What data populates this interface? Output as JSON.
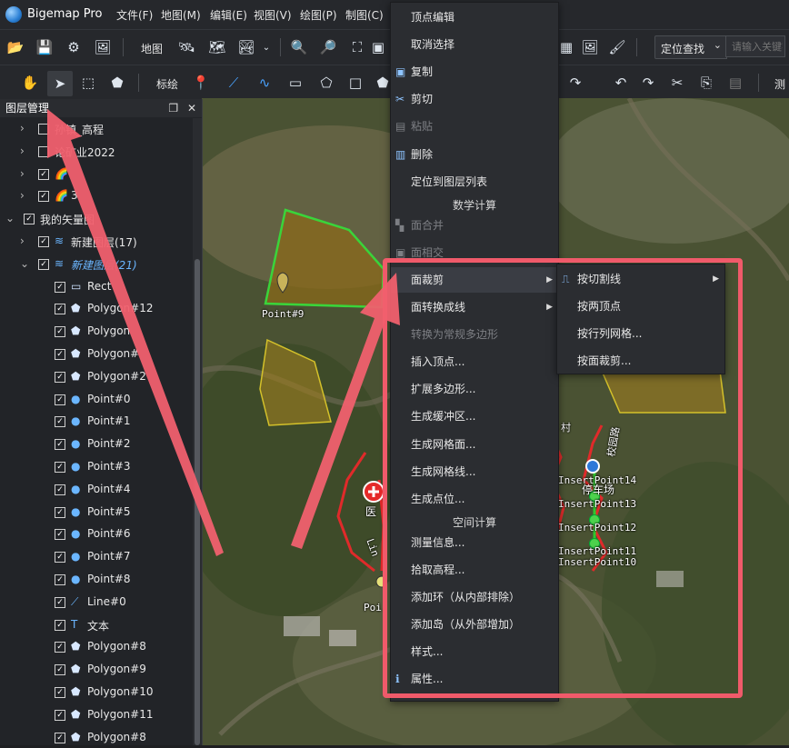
{
  "app": {
    "title": "Bigemap Pro"
  },
  "menubar": [
    "文件(F)",
    "地图(M)",
    "编辑(E)",
    "视图(V)",
    "绘图(P)",
    "制图(C)"
  ],
  "toolbar1": {
    "map_label": "地图",
    "locate_dropdown": "定位查找",
    "search_placeholder": "请输入关键字"
  },
  "toolbar2": {
    "annotate_label": "标绘",
    "measure_label": "测"
  },
  "layer_panel": {
    "title": "图层管理",
    "items": [
      {
        "label": "孙镇_高程",
        "depth": 1,
        "expand": "›",
        "checked": false,
        "icon": "layer-icon"
      },
      {
        "label": "论矿业2022",
        "depth": 1,
        "expand": "›",
        "checked": false,
        "icon": "layer-icon"
      },
      {
        "label": "",
        "depth": 1,
        "expand": "›",
        "checked": true,
        "icon": "raster-icon"
      },
      {
        "label": "3",
        "depth": 1,
        "expand": "›",
        "checked": true,
        "icon": "raster-icon"
      },
      {
        "label": "我的矢量图",
        "depth": 0,
        "expand": "⌄",
        "checked": true,
        "icon": "none"
      },
      {
        "label": "新建图层(17)",
        "depth": 1,
        "expand": "›",
        "checked": true,
        "icon": "stack-icon"
      },
      {
        "label": "新建图层(21)",
        "depth": 1,
        "expand": "⌄",
        "checked": true,
        "icon": "stack-icon",
        "active": true
      },
      {
        "label": "Rect",
        "depth": 2,
        "checked": true,
        "icon": "rect-icon"
      },
      {
        "label": "Polygon#12",
        "depth": 2,
        "checked": true,
        "icon": "polygon-icon"
      },
      {
        "label": "Polygon",
        "depth": 2,
        "checked": true,
        "icon": "polygon-icon"
      },
      {
        "label": "Polygon#",
        "depth": 2,
        "checked": true,
        "icon": "polygon-icon"
      },
      {
        "label": "Polygon#2",
        "depth": 2,
        "checked": true,
        "icon": "polygon-icon"
      },
      {
        "label": "Point#0",
        "depth": 2,
        "checked": true,
        "icon": "point-icon"
      },
      {
        "label": "Point#1",
        "depth": 2,
        "checked": true,
        "icon": "point-icon"
      },
      {
        "label": "Point#2",
        "depth": 2,
        "checked": true,
        "icon": "point-icon"
      },
      {
        "label": "Point#3",
        "depth": 2,
        "checked": true,
        "icon": "point-icon"
      },
      {
        "label": "Point#4",
        "depth": 2,
        "checked": true,
        "icon": "point-icon"
      },
      {
        "label": "Point#5",
        "depth": 2,
        "checked": true,
        "icon": "point-icon"
      },
      {
        "label": "Point#6",
        "depth": 2,
        "checked": true,
        "icon": "point-icon"
      },
      {
        "label": "Point#7",
        "depth": 2,
        "checked": true,
        "icon": "point-icon"
      },
      {
        "label": "Point#8",
        "depth": 2,
        "checked": true,
        "icon": "point-icon"
      },
      {
        "label": "Line#0",
        "depth": 2,
        "checked": true,
        "icon": "line-icon"
      },
      {
        "label": "文本",
        "depth": 2,
        "checked": true,
        "icon": "text-icon"
      },
      {
        "label": "Polygon#8",
        "depth": 2,
        "checked": true,
        "icon": "polygon-icon"
      },
      {
        "label": "Polygon#9",
        "depth": 2,
        "checked": true,
        "icon": "polygon-icon"
      },
      {
        "label": "Polygon#10",
        "depth": 2,
        "checked": true,
        "icon": "polygon-icon"
      },
      {
        "label": "Polygon#11",
        "depth": 2,
        "checked": true,
        "icon": "polygon-icon"
      },
      {
        "label": "Polygon#8",
        "depth": 2,
        "checked": true,
        "icon": "polygon-icon"
      }
    ]
  },
  "context_menu": {
    "items": [
      {
        "label": "顶点编辑",
        "icon": "",
        "disabled": false
      },
      {
        "label": "取消选择",
        "icon": "",
        "disabled": false
      },
      {
        "label": "复制",
        "icon": "copy-icon",
        "disabled": false
      },
      {
        "label": "剪切",
        "icon": "scissors-icon",
        "disabled": false
      },
      {
        "label": "粘贴",
        "icon": "paste-icon",
        "disabled": true
      },
      {
        "label": "删除",
        "icon": "delete-icon",
        "disabled": false
      },
      {
        "label": "定位到图层列表",
        "icon": "",
        "disabled": false
      },
      {
        "header": "数学计算"
      },
      {
        "label": "面合并",
        "icon": "merge-icon",
        "disabled": true
      },
      {
        "label": "面相交",
        "icon": "intersect-icon",
        "disabled": true
      },
      {
        "label": "面裁剪",
        "icon": "",
        "disabled": false,
        "submenu": true,
        "highlight": true
      },
      {
        "label": "面转换成线",
        "icon": "",
        "disabled": false,
        "submenu": true
      },
      {
        "label": "转换为常规多边形",
        "icon": "",
        "disabled": true
      },
      {
        "label": "插入顶点...",
        "icon": "",
        "disabled": false
      },
      {
        "label": "扩展多边形...",
        "icon": "",
        "disabled": false
      },
      {
        "label": "生成缓冲区...",
        "icon": "",
        "disabled": false
      },
      {
        "label": "生成网格面...",
        "icon": "",
        "disabled": false
      },
      {
        "label": "生成网格线...",
        "icon": "",
        "disabled": false
      },
      {
        "label": "生成点位...",
        "icon": "",
        "disabled": false
      },
      {
        "header": "空间计算"
      },
      {
        "label": "测量信息...",
        "icon": "",
        "disabled": false
      },
      {
        "label": "拾取高程...",
        "icon": "",
        "disabled": false
      },
      {
        "label": "添加环（从内部排除）",
        "icon": "",
        "disabled": false
      },
      {
        "label": "添加岛（从外部增加）",
        "icon": "",
        "disabled": false
      },
      {
        "label": "样式...",
        "icon": "",
        "disabled": false
      },
      {
        "label": "属性...",
        "icon": "info-icon",
        "disabled": false
      }
    ]
  },
  "submenu": {
    "items": [
      {
        "label": "按切割线",
        "submenu": true
      },
      {
        "label": "按两顶点"
      },
      {
        "label": "按行列网格..."
      },
      {
        "label": "按面裁剪..."
      }
    ]
  },
  "map": {
    "labels": [
      "Point#9",
      "InsertPoint14",
      "InsertPoint13",
      "InsertPoint12",
      "InsertPoint11",
      "InsertPoint10",
      "医",
      "Poi",
      "Lin",
      "停车场",
      "村",
      "校园路"
    ]
  },
  "colors": {
    "highlight_box": "#f05a6a",
    "arrow": "#f0606e",
    "polygon_fill": "#8a6a1a",
    "polygon_green": "#3ad43a",
    "polygon_yellow": "#d4c12a"
  }
}
